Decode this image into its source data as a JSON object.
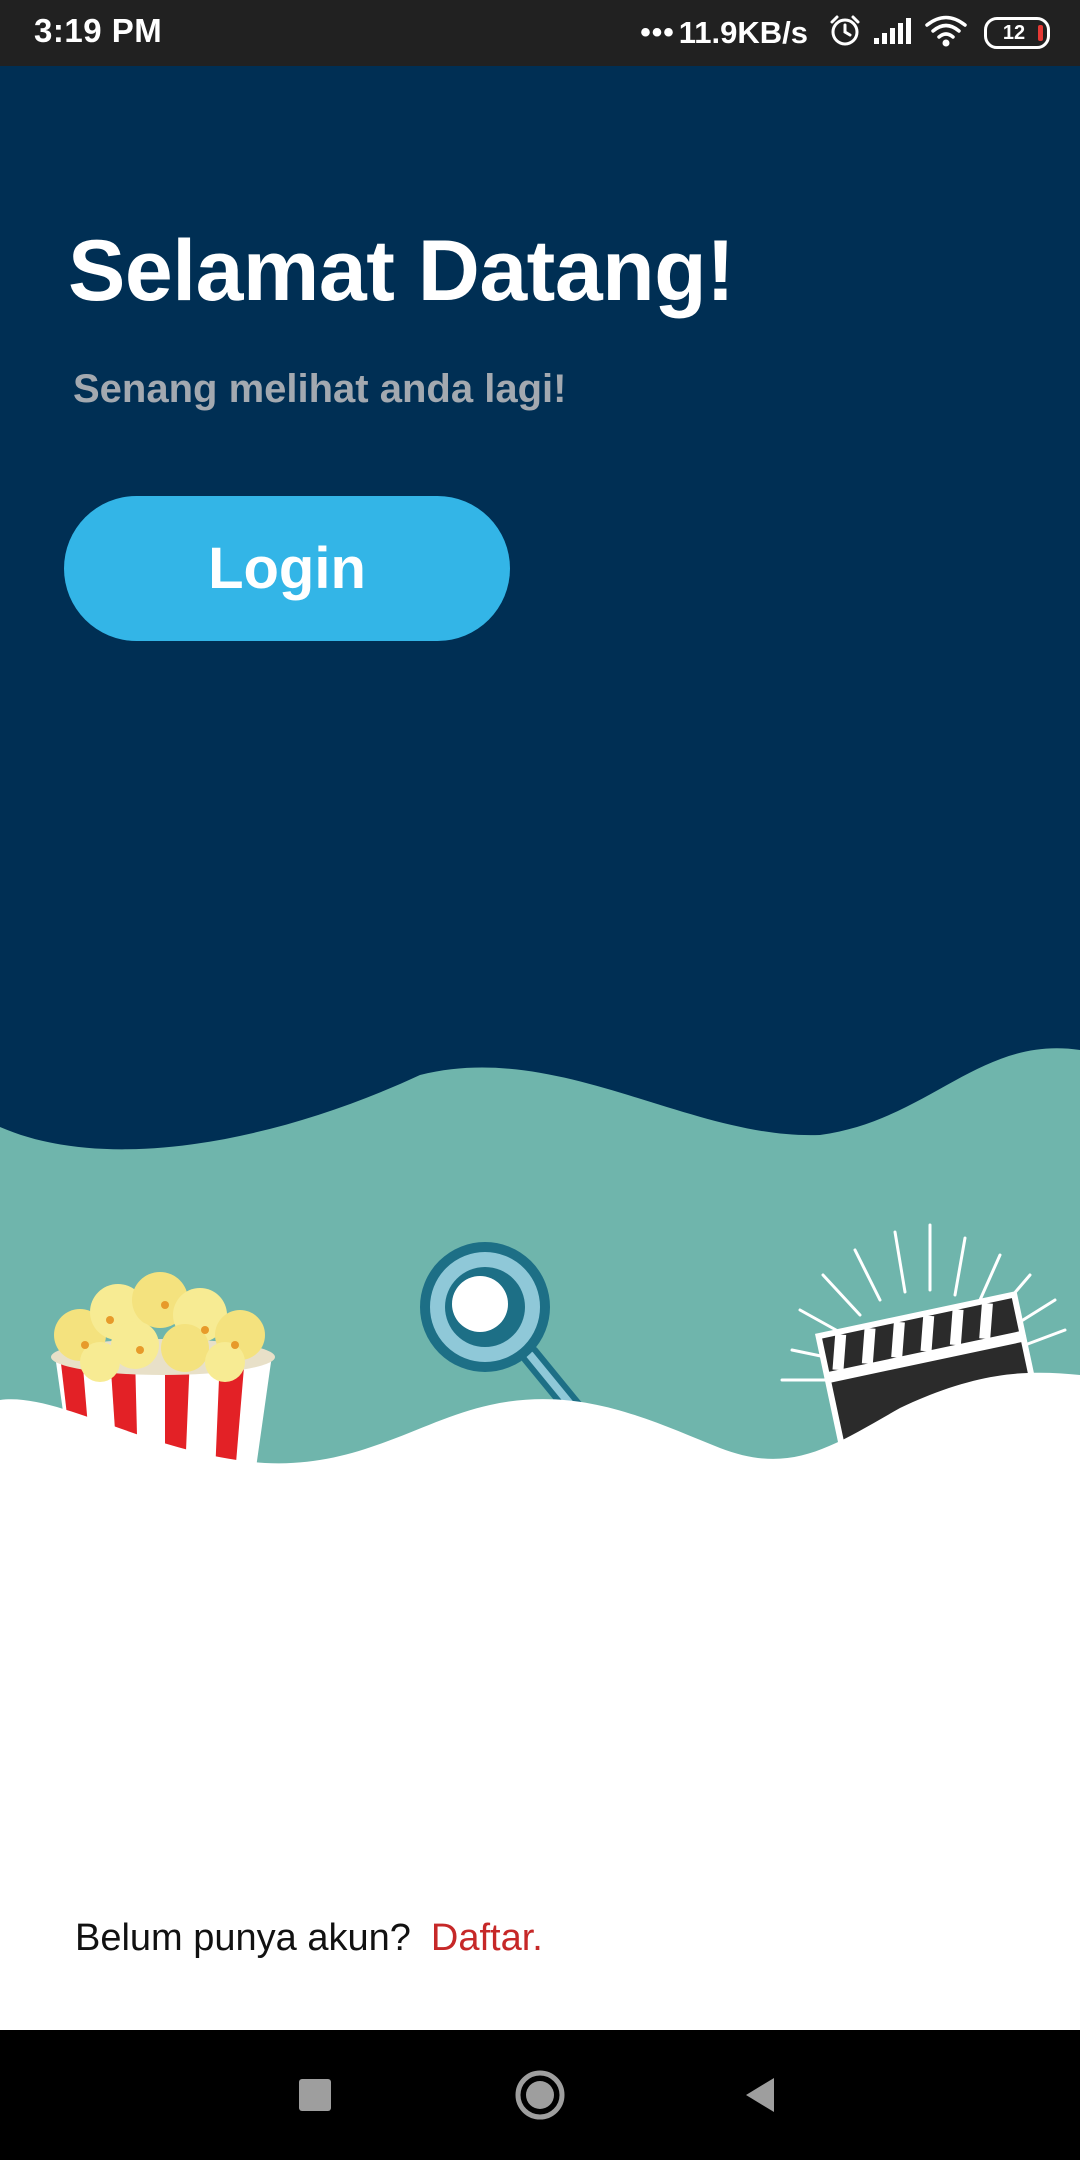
{
  "status_bar": {
    "time": "3:19 PM",
    "dots": "•••",
    "network_speed": "11.9KB/s",
    "battery": "12",
    "icons": [
      "alarm-icon",
      "signal-icon",
      "wifi-icon",
      "battery-icon"
    ]
  },
  "welcome": {
    "title": "Selamat Datang!",
    "subtitle": "Senang melihat anda lagi!",
    "login_label": "Login"
  },
  "illustrations": [
    "popcorn-icon",
    "magnifier-icon",
    "clapperboard-icon"
  ],
  "footer": {
    "prompt": "Belum punya akun?",
    "link": "Daftar."
  },
  "nav_bar": {
    "icons": [
      "recents-icon",
      "home-icon",
      "back-icon"
    ]
  },
  "colors": {
    "hero_background": "#002f54",
    "wave_teal": "#6fb5ac",
    "button_blue": "#33b5e7",
    "link_red": "#c62828"
  }
}
